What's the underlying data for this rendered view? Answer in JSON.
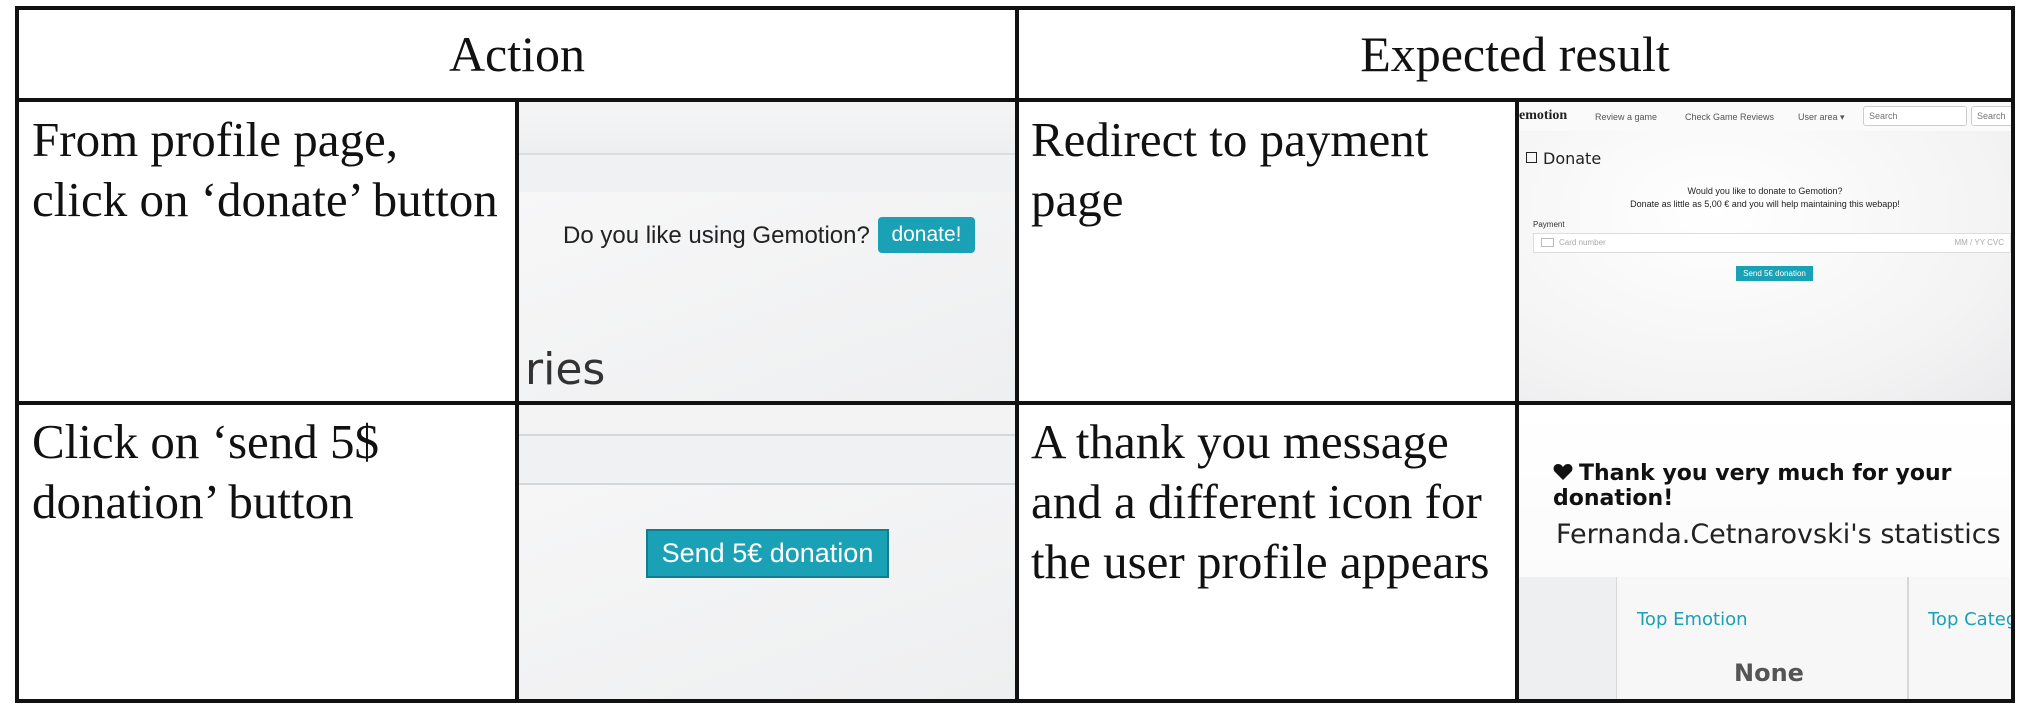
{
  "table": {
    "headers": {
      "action": "Action",
      "expected": "Expected result"
    },
    "rows": [
      {
        "action_text": [
          "From profile page,",
          "click on ‘donate’ button"
        ],
        "expected_text": [
          "Redirect to payment",
          "page"
        ]
      },
      {
        "action_text": [
          "Click on ‘send 5$",
          "donation’ button"
        ],
        "expected_text": [
          "A thank you message",
          "and a different icon for",
          "the user profile appears"
        ]
      }
    ]
  },
  "shot_profile": {
    "question": "Do you like using Gemotion?",
    "donate_label": "donate!",
    "partial_heading": "ries"
  },
  "shot_send": {
    "button_label": "Send 5€ donation"
  },
  "shot_payment": {
    "brand": "emotion",
    "nav": {
      "review": "Review a game",
      "check": "Check Game Reviews",
      "user_area": "User area ▾",
      "search_placeholder": "Search",
      "search_button": "Search ga"
    },
    "title": "Donate",
    "message_1": "Would you like to donate to Gemotion?",
    "message_2": "Donate as little as 5,00 € and you will help maintaining this webapp!",
    "payment_label": "Payment",
    "card_placeholder": "Card number",
    "card_meta": "MM / YY  CVC",
    "send_label": "Send 5€ donation"
  },
  "shot_thanks": {
    "thank_message": "Thank you very much for your donation!",
    "statistics_title": "Fernanda.Cetnarovski's statistics",
    "top_emotion_label": "Top Emotion",
    "top_emotion_value": "None",
    "top_category_label": "Top Catego"
  },
  "colors": {
    "accent": "#1aa1b5",
    "border": "#111111"
  }
}
